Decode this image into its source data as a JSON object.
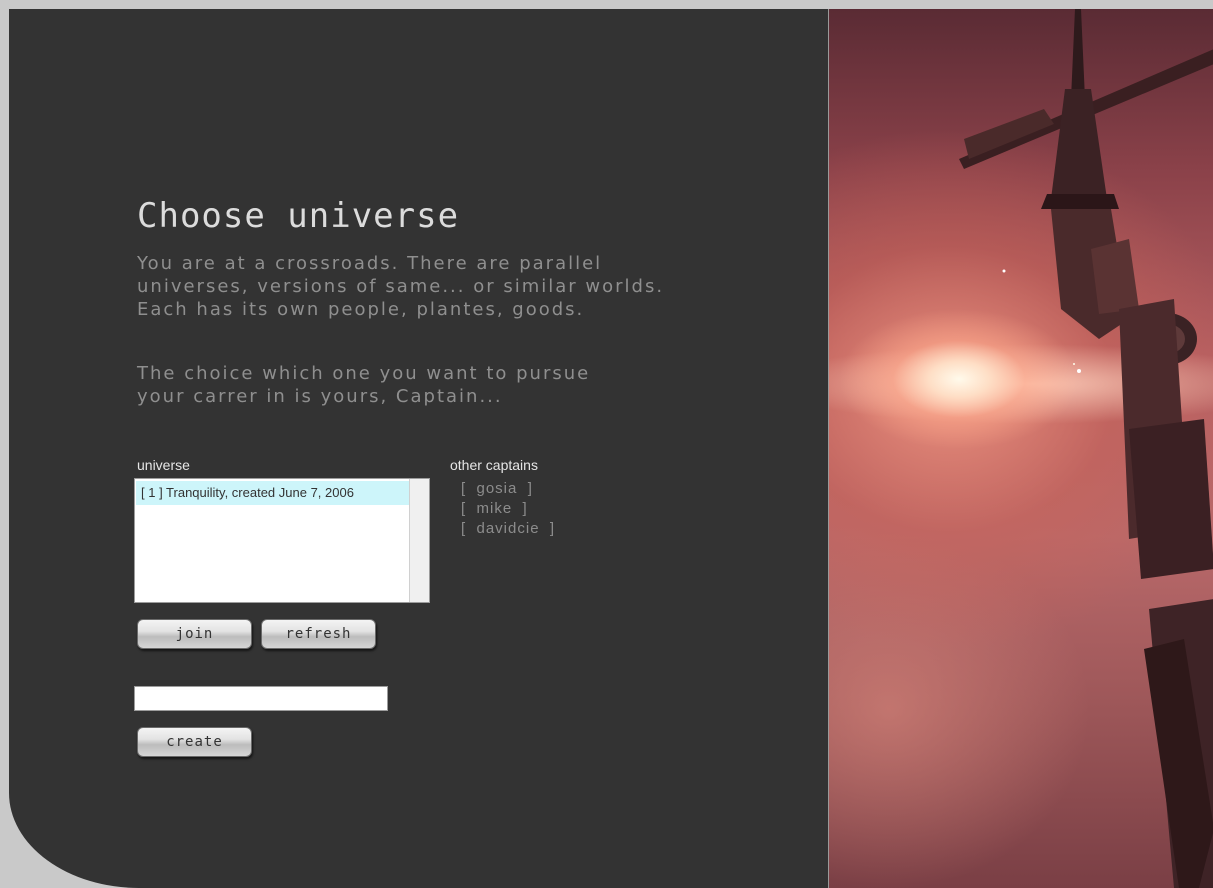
{
  "page": {
    "title": "Choose universe",
    "intro_paragraph_1": "You are at a crossroads. There are parallel\nuniverses, versions of same... or similar worlds.\nEach has its own people, plantes, goods.",
    "intro_paragraph_2": "The choice which one you want to pursue\nyour carrer in is yours, Captain..."
  },
  "universe_panel": {
    "label": "universe",
    "items": [
      {
        "label": "[ 1 ] Tranquility, created June 7, 2006",
        "selected": true
      }
    ]
  },
  "captains_panel": {
    "label": "other captains",
    "captains": [
      "[  gosia  ]",
      "[  mike  ]",
      "[  davidcie  ]"
    ]
  },
  "actions": {
    "join_label": "join",
    "refresh_label": "refresh",
    "create_label": "create",
    "new_universe_value": ""
  },
  "colors": {
    "panel_background": "#333333",
    "selected_item": "#cdf5fa",
    "title_text": "#dcdcdc",
    "intro_text": "#8f8f8f"
  },
  "icons": {
    "hero_image": "space-station-nebula-image"
  }
}
